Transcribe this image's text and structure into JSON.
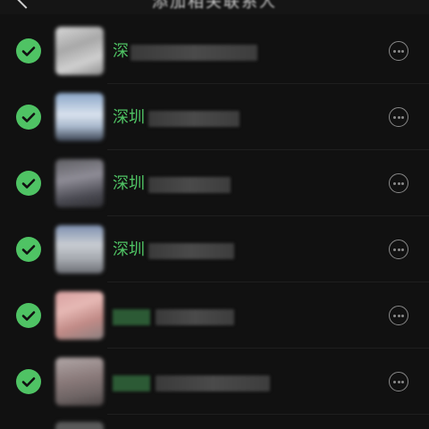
{
  "header": {
    "title": "添加相关联系人"
  },
  "colors": {
    "accent_green": "#4fc364",
    "background": "#111111",
    "icon_gray": "#8a8a8a"
  },
  "rows": [
    {
      "name_prefix": "深",
      "checked": true
    },
    {
      "name_prefix": "深圳",
      "checked": true
    },
    {
      "name_prefix": "深圳",
      "checked": true
    },
    {
      "name_prefix": "深圳",
      "checked": true
    },
    {
      "name_prefix": "",
      "checked": true
    },
    {
      "name_prefix": "",
      "checked": true
    }
  ]
}
